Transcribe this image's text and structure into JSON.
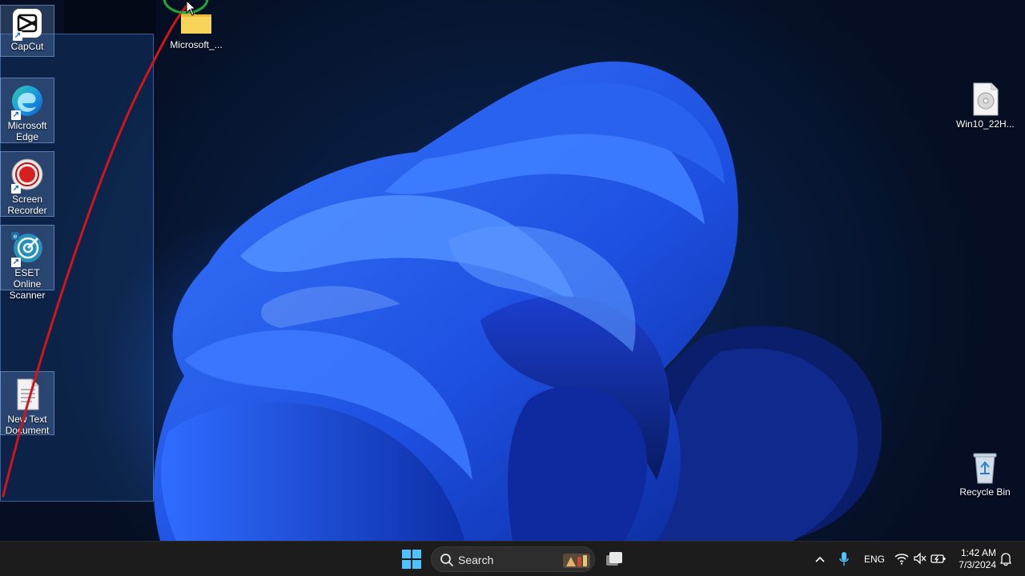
{
  "desktop": {
    "icons": [
      {
        "label": "CapCut",
        "icon": "capcut-icon"
      },
      {
        "label": "Microsoft Edge",
        "icon": "edge-icon"
      },
      {
        "label": "Screen Recorder",
        "icon": "screen-recorder-icon"
      },
      {
        "label": "ESET Online Scanner",
        "icon": "eset-scanner-icon"
      },
      {
        "label": "New Text Document",
        "icon": "text-document-icon"
      },
      {
        "label": "Microsoft_...",
        "icon": "folder-icon"
      },
      {
        "label": "Win10_22H...",
        "icon": "disc-image-icon"
      },
      {
        "label": "Recycle Bin",
        "icon": "recycle-bin-icon"
      }
    ],
    "annotation_color": "#d0161c",
    "cursor_ring_color": "#1fa83a"
  },
  "taskbar": {
    "search_label": "Search",
    "language": "ENG",
    "time": "1:42 AM",
    "date": "7/3/2024",
    "accent": "#4cc2ff"
  }
}
